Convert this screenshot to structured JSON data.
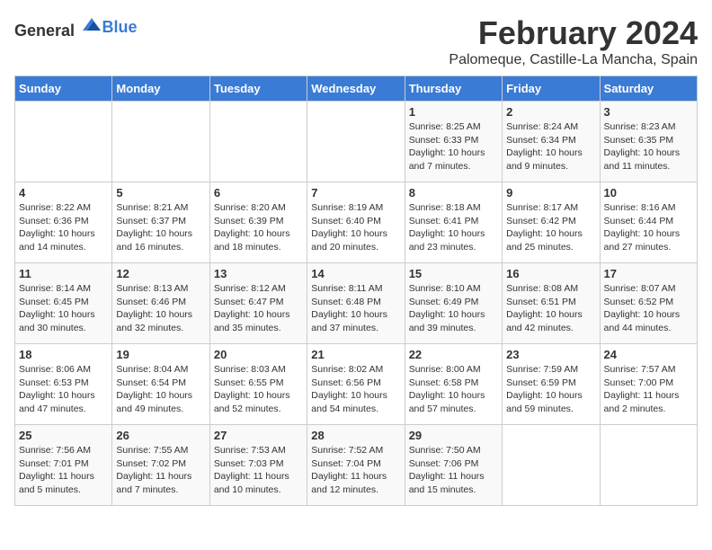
{
  "header": {
    "logo_general": "General",
    "logo_blue": "Blue",
    "month": "February 2024",
    "location": "Palomeque, Castille-La Mancha, Spain"
  },
  "weekdays": [
    "Sunday",
    "Monday",
    "Tuesday",
    "Wednesday",
    "Thursday",
    "Friday",
    "Saturday"
  ],
  "weeks": [
    [
      {
        "day": "",
        "info": ""
      },
      {
        "day": "",
        "info": ""
      },
      {
        "day": "",
        "info": ""
      },
      {
        "day": "",
        "info": ""
      },
      {
        "day": "1",
        "info": "Sunrise: 8:25 AM\nSunset: 6:33 PM\nDaylight: 10 hours\nand 7 minutes."
      },
      {
        "day": "2",
        "info": "Sunrise: 8:24 AM\nSunset: 6:34 PM\nDaylight: 10 hours\nand 9 minutes."
      },
      {
        "day": "3",
        "info": "Sunrise: 8:23 AM\nSunset: 6:35 PM\nDaylight: 10 hours\nand 11 minutes."
      }
    ],
    [
      {
        "day": "4",
        "info": "Sunrise: 8:22 AM\nSunset: 6:36 PM\nDaylight: 10 hours\nand 14 minutes."
      },
      {
        "day": "5",
        "info": "Sunrise: 8:21 AM\nSunset: 6:37 PM\nDaylight: 10 hours\nand 16 minutes."
      },
      {
        "day": "6",
        "info": "Sunrise: 8:20 AM\nSunset: 6:39 PM\nDaylight: 10 hours\nand 18 minutes."
      },
      {
        "day": "7",
        "info": "Sunrise: 8:19 AM\nSunset: 6:40 PM\nDaylight: 10 hours\nand 20 minutes."
      },
      {
        "day": "8",
        "info": "Sunrise: 8:18 AM\nSunset: 6:41 PM\nDaylight: 10 hours\nand 23 minutes."
      },
      {
        "day": "9",
        "info": "Sunrise: 8:17 AM\nSunset: 6:42 PM\nDaylight: 10 hours\nand 25 minutes."
      },
      {
        "day": "10",
        "info": "Sunrise: 8:16 AM\nSunset: 6:44 PM\nDaylight: 10 hours\nand 27 minutes."
      }
    ],
    [
      {
        "day": "11",
        "info": "Sunrise: 8:14 AM\nSunset: 6:45 PM\nDaylight: 10 hours\nand 30 minutes."
      },
      {
        "day": "12",
        "info": "Sunrise: 8:13 AM\nSunset: 6:46 PM\nDaylight: 10 hours\nand 32 minutes."
      },
      {
        "day": "13",
        "info": "Sunrise: 8:12 AM\nSunset: 6:47 PM\nDaylight: 10 hours\nand 35 minutes."
      },
      {
        "day": "14",
        "info": "Sunrise: 8:11 AM\nSunset: 6:48 PM\nDaylight: 10 hours\nand 37 minutes."
      },
      {
        "day": "15",
        "info": "Sunrise: 8:10 AM\nSunset: 6:49 PM\nDaylight: 10 hours\nand 39 minutes."
      },
      {
        "day": "16",
        "info": "Sunrise: 8:08 AM\nSunset: 6:51 PM\nDaylight: 10 hours\nand 42 minutes."
      },
      {
        "day": "17",
        "info": "Sunrise: 8:07 AM\nSunset: 6:52 PM\nDaylight: 10 hours\nand 44 minutes."
      }
    ],
    [
      {
        "day": "18",
        "info": "Sunrise: 8:06 AM\nSunset: 6:53 PM\nDaylight: 10 hours\nand 47 minutes."
      },
      {
        "day": "19",
        "info": "Sunrise: 8:04 AM\nSunset: 6:54 PM\nDaylight: 10 hours\nand 49 minutes."
      },
      {
        "day": "20",
        "info": "Sunrise: 8:03 AM\nSunset: 6:55 PM\nDaylight: 10 hours\nand 52 minutes."
      },
      {
        "day": "21",
        "info": "Sunrise: 8:02 AM\nSunset: 6:56 PM\nDaylight: 10 hours\nand 54 minutes."
      },
      {
        "day": "22",
        "info": "Sunrise: 8:00 AM\nSunset: 6:58 PM\nDaylight: 10 hours\nand 57 minutes."
      },
      {
        "day": "23",
        "info": "Sunrise: 7:59 AM\nSunset: 6:59 PM\nDaylight: 10 hours\nand 59 minutes."
      },
      {
        "day": "24",
        "info": "Sunrise: 7:57 AM\nSunset: 7:00 PM\nDaylight: 11 hours\nand 2 minutes."
      }
    ],
    [
      {
        "day": "25",
        "info": "Sunrise: 7:56 AM\nSunset: 7:01 PM\nDaylight: 11 hours\nand 5 minutes."
      },
      {
        "day": "26",
        "info": "Sunrise: 7:55 AM\nSunset: 7:02 PM\nDaylight: 11 hours\nand 7 minutes."
      },
      {
        "day": "27",
        "info": "Sunrise: 7:53 AM\nSunset: 7:03 PM\nDaylight: 11 hours\nand 10 minutes."
      },
      {
        "day": "28",
        "info": "Sunrise: 7:52 AM\nSunset: 7:04 PM\nDaylight: 11 hours\nand 12 minutes."
      },
      {
        "day": "29",
        "info": "Sunrise: 7:50 AM\nSunset: 7:06 PM\nDaylight: 11 hours\nand 15 minutes."
      },
      {
        "day": "",
        "info": ""
      },
      {
        "day": "",
        "info": ""
      }
    ]
  ]
}
